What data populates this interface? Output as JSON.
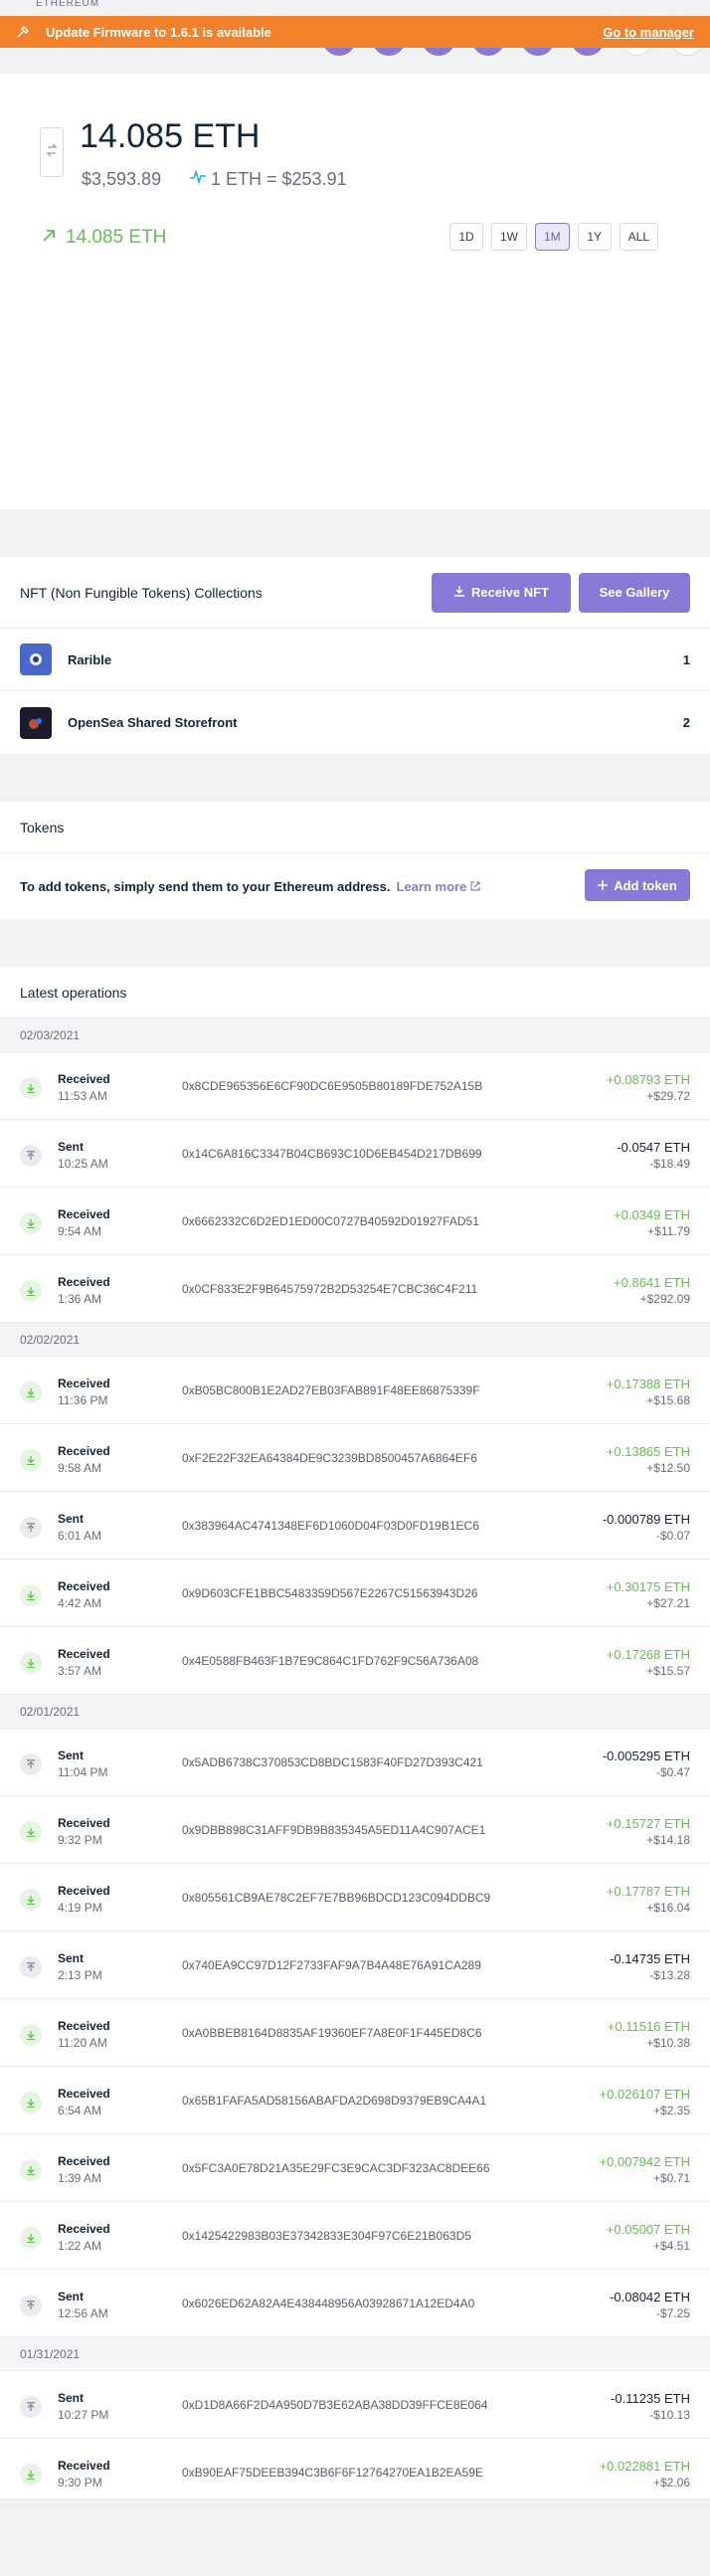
{
  "header": {
    "crypto_label": "ETHEREUM"
  },
  "banner": {
    "text": "Update Firmware to 1.6.1 is available",
    "link": "Go to manager",
    "color": "#f1812a"
  },
  "balance": {
    "amount": "14.085 ETH",
    "fiat": "$3,593.89",
    "rate": "1 ETH = $253.91",
    "delta": "14.085 ETH",
    "ranges": [
      "1D",
      "1W",
      "1M",
      "1Y",
      "ALL"
    ],
    "active_range": "1M"
  },
  "nft": {
    "title": "NFT (Non Fungible Tokens) Collections",
    "receive_label": "Receive NFT",
    "gallery_label": "See Gallery",
    "collections": [
      {
        "name": "Rarible",
        "count": "1"
      },
      {
        "name": "OpenSea Shared Storefront",
        "count": "2"
      }
    ]
  },
  "tokens": {
    "title": "Tokens",
    "text": "To add tokens, simply send them to your Ethereum address.",
    "learn_more": "Learn more",
    "add_label": "Add token"
  },
  "operations": {
    "title": "Latest operations",
    "days": [
      {
        "date": "02/03/2021",
        "ops": [
          {
            "type": "Received",
            "time": "11:53 AM",
            "hash": "0x8CDE965356E6CF90DC6E9505B80189FDE752A15B",
            "amount": "+0.08793 ETH",
            "fiat": "+$29.72",
            "dir": "in"
          },
          {
            "type": "Sent",
            "time": "10:25 AM",
            "hash": "0x14C6A816C3347B04CB693C10D6EB454D217DB699",
            "amount": "-0.0547 ETH",
            "fiat": "-$18.49",
            "dir": "out"
          },
          {
            "type": "Received",
            "time": "9:54 AM",
            "hash": "0x6662332C6D2ED1ED00C0727B40592D01927FAD51",
            "amount": "+0.0349 ETH",
            "fiat": "+$11.79",
            "dir": "in"
          },
          {
            "type": "Received",
            "time": "1:36 AM",
            "hash": "0x0CF833E2F9B64575972B2D53254E7CBC36C4F211",
            "amount": "+0.8641 ETH",
            "fiat": "+$292.09",
            "dir": "in"
          }
        ]
      },
      {
        "date": "02/02/2021",
        "ops": [
          {
            "type": "Received",
            "time": "11:36 PM",
            "hash": "0xB05BC800B1E2AD27EB03FAB891F48EE86875339F",
            "amount": "+0.17388 ETH",
            "fiat": "+$15.68",
            "dir": "in"
          },
          {
            "type": "Received",
            "time": "9:58 AM",
            "hash": "0xF2E22F32EA64384DE9C3239BD8500457A6864EF6",
            "amount": "+0.13865 ETH",
            "fiat": "+$12.50",
            "dir": "in"
          },
          {
            "type": "Sent",
            "time": "6:01 AM",
            "hash": "0x383964AC4741348EF6D1060D04F03D0FD19B1EC6",
            "amount": "-0.000789 ETH",
            "fiat": "-$0.07",
            "dir": "out"
          },
          {
            "type": "Received",
            "time": "4:42 AM",
            "hash": "0x9D603CFE1BBC5483359D567E2267C51563943D26",
            "amount": "+0.30175 ETH",
            "fiat": "+$27.21",
            "dir": "in"
          },
          {
            "type": "Received",
            "time": "3:57 AM",
            "hash": "0x4E0588FB463F1B7E9C864C1FD762F9C56A736A08",
            "amount": "+0.17268 ETH",
            "fiat": "+$15.57",
            "dir": "in"
          }
        ]
      },
      {
        "date": "02/01/2021",
        "ops": [
          {
            "type": "Sent",
            "time": "11:04 PM",
            "hash": "0x5ADB6738C370853CD8BDC1583F40FD27D393C421",
            "amount": "-0.005295 ETH",
            "fiat": "-$0.47",
            "dir": "out"
          },
          {
            "type": "Received",
            "time": "9:32 PM",
            "hash": "0x9DBB898C31AFF9DB9B835345A5ED11A4C907ACE1",
            "amount": "+0.15727 ETH",
            "fiat": "+$14.18",
            "dir": "in"
          },
          {
            "type": "Received",
            "time": "4:19 PM",
            "hash": "0x805561CB9AE78C2EF7E7BB96BDCD123C094DDBC9",
            "amount": "+0.17787 ETH",
            "fiat": "+$16.04",
            "dir": "in"
          },
          {
            "type": "Sent",
            "time": "2:13 PM",
            "hash": "0x740EA9CC97D12F2733FAF9A7B4A48E76A91CA289",
            "amount": "-0.14735 ETH",
            "fiat": "-$13.28",
            "dir": "out"
          },
          {
            "type": "Received",
            "time": "11:20 AM",
            "hash": "0xA0BBEB8164D8835AF19360EF7A8E0F1F445ED8C6",
            "amount": "+0.11516 ETH",
            "fiat": "+$10.38",
            "dir": "in"
          },
          {
            "type": "Received",
            "time": "6:54 AM",
            "hash": "0x65B1FAFA5AD58156ABAFDA2D698D9379EB9CA4A1",
            "amount": "+0.026107 ETH",
            "fiat": "+$2.35",
            "dir": "in"
          },
          {
            "type": "Received",
            "time": "1:39 AM",
            "hash": "0x5FC3A0E78D21A35E29FC3E9CAC3DF323AC8DEE66",
            "amount": "+0.007942 ETH",
            "fiat": "+$0.71",
            "dir": "in"
          },
          {
            "type": "Received",
            "time": "1:22 AM",
            "hash": "0x1425422983B03E37342833E304F97C6E21B063D5",
            "amount": "+0.05007 ETH",
            "fiat": "+$4.51",
            "dir": "in"
          },
          {
            "type": "Sent",
            "time": "12:56 AM",
            "hash": "0x6026ED62A82A4E438448956A03928671A12ED4A0",
            "amount": "-0.08042 ETH",
            "fiat": "-$7.25",
            "dir": "out"
          }
        ]
      },
      {
        "date": "01/31/2021",
        "ops": [
          {
            "type": "Sent",
            "time": "10:27 PM",
            "hash": "0xD1D8A66F2D4A950D7B3E62ABA38DD39FFCE8E064",
            "amount": "-0.11235 ETH",
            "fiat": "-$10.13",
            "dir": "out"
          },
          {
            "type": "Received",
            "time": "9:30 PM",
            "hash": "0xB90EAF75DEEB394C3B6F6F12764270EA1B2EA59E",
            "amount": "+0.022881 ETH",
            "fiat": "+$2.06",
            "dir": "in"
          }
        ]
      }
    ]
  },
  "colors": {
    "accent": "#8979d7",
    "positive": "#66be54",
    "warning": "#f1812a"
  },
  "icons": [
    "usb-icon",
    "swap-icon",
    "activity-icon",
    "arrow-up-right-icon",
    "download-icon",
    "external-link-icon",
    "plus-icon",
    "receive-arrow-icon",
    "send-arrow-icon"
  ]
}
